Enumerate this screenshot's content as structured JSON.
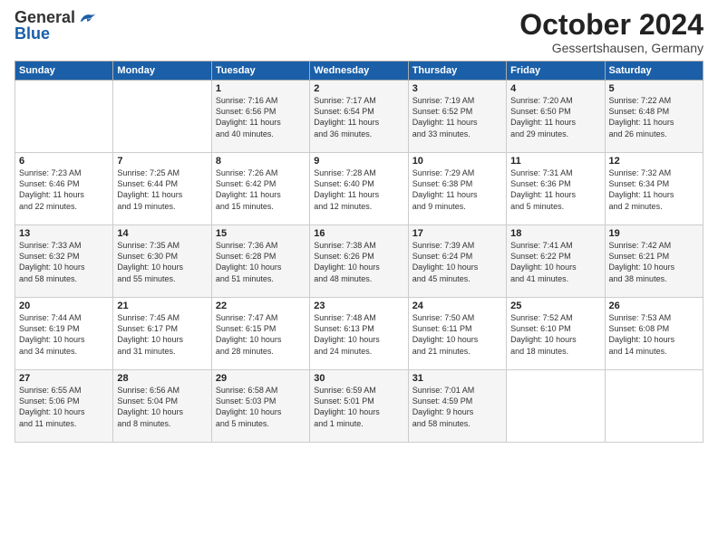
{
  "logo": {
    "line1": "General",
    "line2": "Blue"
  },
  "title": "October 2024",
  "location": "Gessertshausen, Germany",
  "headers": [
    "Sunday",
    "Monday",
    "Tuesday",
    "Wednesday",
    "Thursday",
    "Friday",
    "Saturday"
  ],
  "weeks": [
    [
      {
        "day": "",
        "info": ""
      },
      {
        "day": "",
        "info": ""
      },
      {
        "day": "1",
        "info": "Sunrise: 7:16 AM\nSunset: 6:56 PM\nDaylight: 11 hours\nand 40 minutes."
      },
      {
        "day": "2",
        "info": "Sunrise: 7:17 AM\nSunset: 6:54 PM\nDaylight: 11 hours\nand 36 minutes."
      },
      {
        "day": "3",
        "info": "Sunrise: 7:19 AM\nSunset: 6:52 PM\nDaylight: 11 hours\nand 33 minutes."
      },
      {
        "day": "4",
        "info": "Sunrise: 7:20 AM\nSunset: 6:50 PM\nDaylight: 11 hours\nand 29 minutes."
      },
      {
        "day": "5",
        "info": "Sunrise: 7:22 AM\nSunset: 6:48 PM\nDaylight: 11 hours\nand 26 minutes."
      }
    ],
    [
      {
        "day": "6",
        "info": "Sunrise: 7:23 AM\nSunset: 6:46 PM\nDaylight: 11 hours\nand 22 minutes."
      },
      {
        "day": "7",
        "info": "Sunrise: 7:25 AM\nSunset: 6:44 PM\nDaylight: 11 hours\nand 19 minutes."
      },
      {
        "day": "8",
        "info": "Sunrise: 7:26 AM\nSunset: 6:42 PM\nDaylight: 11 hours\nand 15 minutes."
      },
      {
        "day": "9",
        "info": "Sunrise: 7:28 AM\nSunset: 6:40 PM\nDaylight: 11 hours\nand 12 minutes."
      },
      {
        "day": "10",
        "info": "Sunrise: 7:29 AM\nSunset: 6:38 PM\nDaylight: 11 hours\nand 9 minutes."
      },
      {
        "day": "11",
        "info": "Sunrise: 7:31 AM\nSunset: 6:36 PM\nDaylight: 11 hours\nand 5 minutes."
      },
      {
        "day": "12",
        "info": "Sunrise: 7:32 AM\nSunset: 6:34 PM\nDaylight: 11 hours\nand 2 minutes."
      }
    ],
    [
      {
        "day": "13",
        "info": "Sunrise: 7:33 AM\nSunset: 6:32 PM\nDaylight: 10 hours\nand 58 minutes."
      },
      {
        "day": "14",
        "info": "Sunrise: 7:35 AM\nSunset: 6:30 PM\nDaylight: 10 hours\nand 55 minutes."
      },
      {
        "day": "15",
        "info": "Sunrise: 7:36 AM\nSunset: 6:28 PM\nDaylight: 10 hours\nand 51 minutes."
      },
      {
        "day": "16",
        "info": "Sunrise: 7:38 AM\nSunset: 6:26 PM\nDaylight: 10 hours\nand 48 minutes."
      },
      {
        "day": "17",
        "info": "Sunrise: 7:39 AM\nSunset: 6:24 PM\nDaylight: 10 hours\nand 45 minutes."
      },
      {
        "day": "18",
        "info": "Sunrise: 7:41 AM\nSunset: 6:22 PM\nDaylight: 10 hours\nand 41 minutes."
      },
      {
        "day": "19",
        "info": "Sunrise: 7:42 AM\nSunset: 6:21 PM\nDaylight: 10 hours\nand 38 minutes."
      }
    ],
    [
      {
        "day": "20",
        "info": "Sunrise: 7:44 AM\nSunset: 6:19 PM\nDaylight: 10 hours\nand 34 minutes."
      },
      {
        "day": "21",
        "info": "Sunrise: 7:45 AM\nSunset: 6:17 PM\nDaylight: 10 hours\nand 31 minutes."
      },
      {
        "day": "22",
        "info": "Sunrise: 7:47 AM\nSunset: 6:15 PM\nDaylight: 10 hours\nand 28 minutes."
      },
      {
        "day": "23",
        "info": "Sunrise: 7:48 AM\nSunset: 6:13 PM\nDaylight: 10 hours\nand 24 minutes."
      },
      {
        "day": "24",
        "info": "Sunrise: 7:50 AM\nSunset: 6:11 PM\nDaylight: 10 hours\nand 21 minutes."
      },
      {
        "day": "25",
        "info": "Sunrise: 7:52 AM\nSunset: 6:10 PM\nDaylight: 10 hours\nand 18 minutes."
      },
      {
        "day": "26",
        "info": "Sunrise: 7:53 AM\nSunset: 6:08 PM\nDaylight: 10 hours\nand 14 minutes."
      }
    ],
    [
      {
        "day": "27",
        "info": "Sunrise: 6:55 AM\nSunset: 5:06 PM\nDaylight: 10 hours\nand 11 minutes."
      },
      {
        "day": "28",
        "info": "Sunrise: 6:56 AM\nSunset: 5:04 PM\nDaylight: 10 hours\nand 8 minutes."
      },
      {
        "day": "29",
        "info": "Sunrise: 6:58 AM\nSunset: 5:03 PM\nDaylight: 10 hours\nand 5 minutes."
      },
      {
        "day": "30",
        "info": "Sunrise: 6:59 AM\nSunset: 5:01 PM\nDaylight: 10 hours\nand 1 minute."
      },
      {
        "day": "31",
        "info": "Sunrise: 7:01 AM\nSunset: 4:59 PM\nDaylight: 9 hours\nand 58 minutes."
      },
      {
        "day": "",
        "info": ""
      },
      {
        "day": "",
        "info": ""
      }
    ]
  ]
}
